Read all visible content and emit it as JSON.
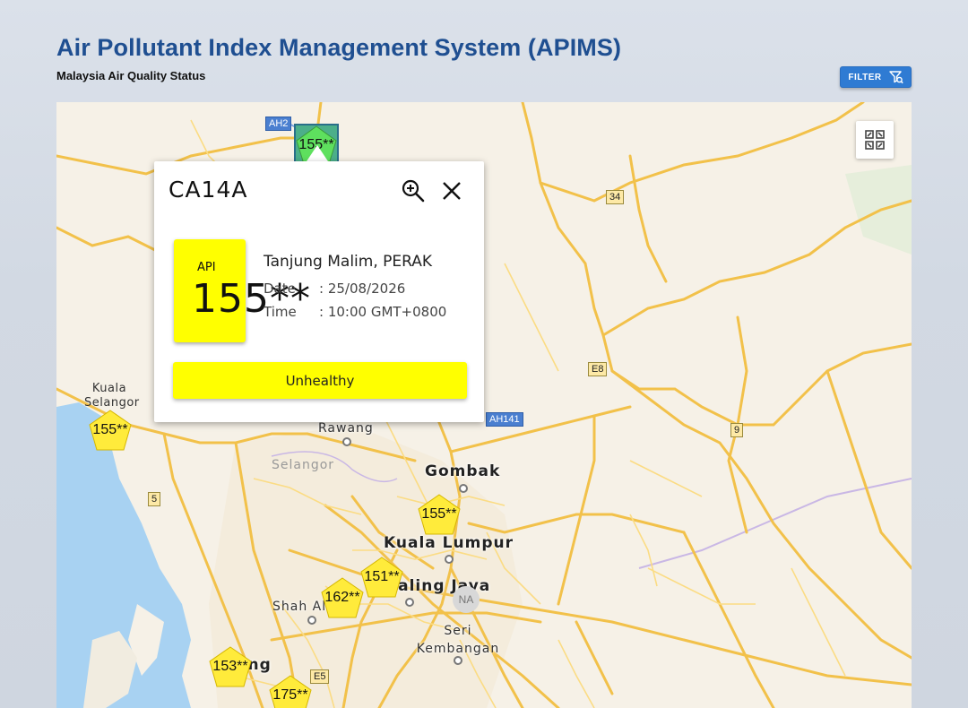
{
  "header": {
    "title": "Air Pollutant Index Management System (APIMS)",
    "subtitle": "Malaysia Air Quality Status",
    "filter_label": "FILTER",
    "filter_icon": "filter-search-icon"
  },
  "map": {
    "fullscreen_icon": "fullscreen-icon",
    "places": {
      "kuala_selangor": "Kuala Selangor",
      "rawang": "Rawang",
      "selangor": "Selangor",
      "gombak": "Gombak",
      "kuala_lumpur": "Kuala Lumpur",
      "petaling_jaya": "Petaling Jaya",
      "shah_alam": "Shah Alam",
      "seri_kembangan": "Seri Kembangan",
      "klang": "Klang",
      "na": "NA"
    },
    "road_labels": {
      "ah2": "AH2",
      "r34": "34",
      "e8": "E8",
      "ah141": "AH141",
      "r9": "9",
      "r5": "5",
      "e5": "E5"
    },
    "markers": [
      {
        "value": "155**",
        "color": "#5ee05e"
      },
      {
        "value": "155**",
        "color": "#ffeb3b"
      },
      {
        "value": "155**",
        "color": "#ffeb3b"
      },
      {
        "value": "151**",
        "color": "#ffeb3b"
      },
      {
        "value": "162**",
        "color": "#ffeb3b"
      },
      {
        "value": "153**",
        "color": "#ffeb3b"
      },
      {
        "value": "175**",
        "color": "#ffeb3b"
      }
    ]
  },
  "popup": {
    "station_id": "CA14A",
    "zoom_icon": "zoom-in-icon",
    "close_icon": "close-icon",
    "api_label": "API",
    "api_value": "155**",
    "location": "Tanjung Malim, PERAK",
    "date_label": "Date",
    "date_value": ": 25/08/2026",
    "time_label": "Time",
    "time_value": ": 10:00 GMT+0800",
    "status": "Unhealthy",
    "status_color": "#ffff00"
  }
}
